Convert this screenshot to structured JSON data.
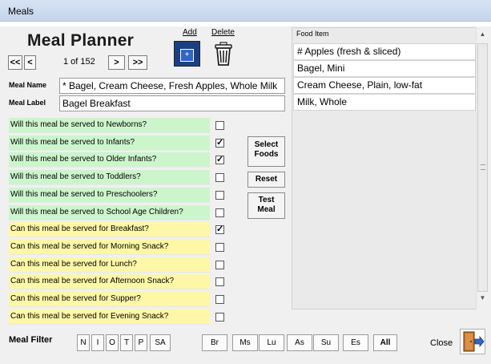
{
  "window": {
    "title": "Meals"
  },
  "header": {
    "app_title": "Meal Planner",
    "nav": {
      "first": "<<",
      "prev": "<",
      "counter": "1 of 152",
      "next": ">",
      "last": ">>"
    },
    "add_label": "Add",
    "delete_label": "Delete"
  },
  "meal": {
    "name_label": "Meal Name",
    "name_value": "* Bagel, Cream Cheese, Fresh Apples, Whole Milk",
    "label_label": "Meal Label",
    "label_value": "Bagel Breakfast"
  },
  "questions": [
    {
      "text": "Will this meal be served to Newborns?",
      "checked": false,
      "color": "#ccf5cc"
    },
    {
      "text": "Will this meal be served to Infants?",
      "checked": true,
      "color": "#ccf5cc"
    },
    {
      "text": "Will this meal be served to Older Infants?",
      "checked": true,
      "color": "#ccf5cc"
    },
    {
      "text": "Will this meal be served to Toddlers?",
      "checked": false,
      "color": "#ccf5cc"
    },
    {
      "text": "Will this meal be served to Preschoolers?",
      "checked": false,
      "color": "#ccf5cc"
    },
    {
      "text": "Will this meal be served to School Age Children?",
      "checked": false,
      "color": "#ccf5cc"
    },
    {
      "text": "Can this meal be served for Breakfast?",
      "checked": true,
      "color": "#fdf7a7"
    },
    {
      "text": "Can this meal be served for Morning Snack?",
      "checked": false,
      "color": "#fdf7a7"
    },
    {
      "text": "Can this meal be served for Lunch?",
      "checked": false,
      "color": "#fdf7a7"
    },
    {
      "text": "Can this meal be served for Afternoon Snack?",
      "checked": false,
      "color": "#fdf7a7"
    },
    {
      "text": "Can this meal be served for Supper?",
      "checked": false,
      "color": "#fdf7a7"
    },
    {
      "text": "Can this meal be served for Evening Snack?",
      "checked": false,
      "color": "#fdf7a7"
    }
  ],
  "actions": {
    "select_foods_l1": "Select",
    "select_foods_l2": "Foods",
    "reset": "Reset",
    "test_meal_l1": "Test",
    "test_meal_l2": "Meal"
  },
  "food_list": {
    "header": "Food Item",
    "items": [
      "# Apples (fresh & sliced)",
      "Bagel, Mini",
      "Cream Cheese, Plain, low-fat",
      "Milk, Whole"
    ]
  },
  "filter": {
    "label": "Meal Filter",
    "age_buttons": [
      "N",
      "I",
      "O",
      "T",
      "P",
      "SA"
    ],
    "meal_buttons": [
      "Br",
      "Ms",
      "Lu",
      "As",
      "Su",
      "Es"
    ],
    "all_label": "All"
  },
  "close_label": "Close",
  "icons": {
    "add": "add-record-icon",
    "delete": "trash-can-icon",
    "close": "exit-door-icon",
    "scroll_up": "scroll-up-arrow-icon",
    "scroll_down": "scroll-down-arrow-icon"
  },
  "colors": {
    "ages_bg": "#ccf5cc",
    "meals_bg": "#fdf7a7",
    "add_button": "#1b3f83"
  }
}
